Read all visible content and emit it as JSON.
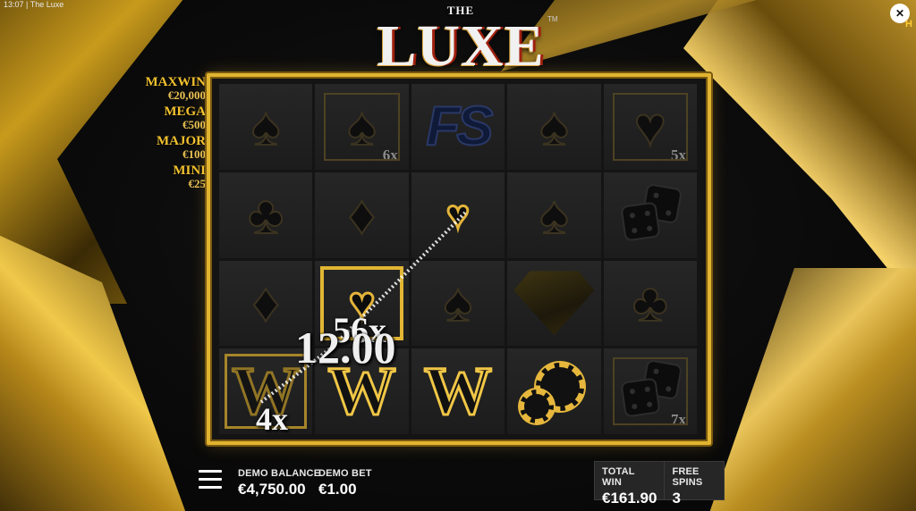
{
  "status_bar": {
    "time": "13:07",
    "title": "The Luxe"
  },
  "corner_tag": "H",
  "logo": {
    "prefix": "THE",
    "main": "LUXE",
    "tm": "TM"
  },
  "jackpots": [
    {
      "label": "MAXWIN",
      "value": "€20,000"
    },
    {
      "label": "MEGA",
      "value": "€500"
    },
    {
      "label": "MAJOR",
      "value": "€100"
    },
    {
      "label": "MINI",
      "value": "€25"
    }
  ],
  "grid": {
    "row1": {
      "c2_mult": "6x",
      "c3_symbol": "FS",
      "c5_mult": "5x"
    },
    "row4": {
      "w1": "W",
      "w2": "W",
      "w3": "W",
      "c5_mult": "7x"
    }
  },
  "win_overlay": {
    "amount": "12.00",
    "mult_a": "56x",
    "mult_b": "4x"
  },
  "bottom_bar": {
    "balance_label": "DEMO BALANCE",
    "balance_value": "€4,750.00",
    "bet_label": "DEMO BET",
    "bet_value": "€1.00",
    "total_win_label": "TOTAL WIN",
    "total_win_value": "€161.90",
    "free_spins_label": "FREE SPINS",
    "free_spins_value": "3"
  },
  "colors": {
    "gold": "#e1b431",
    "panel": "#262626"
  }
}
